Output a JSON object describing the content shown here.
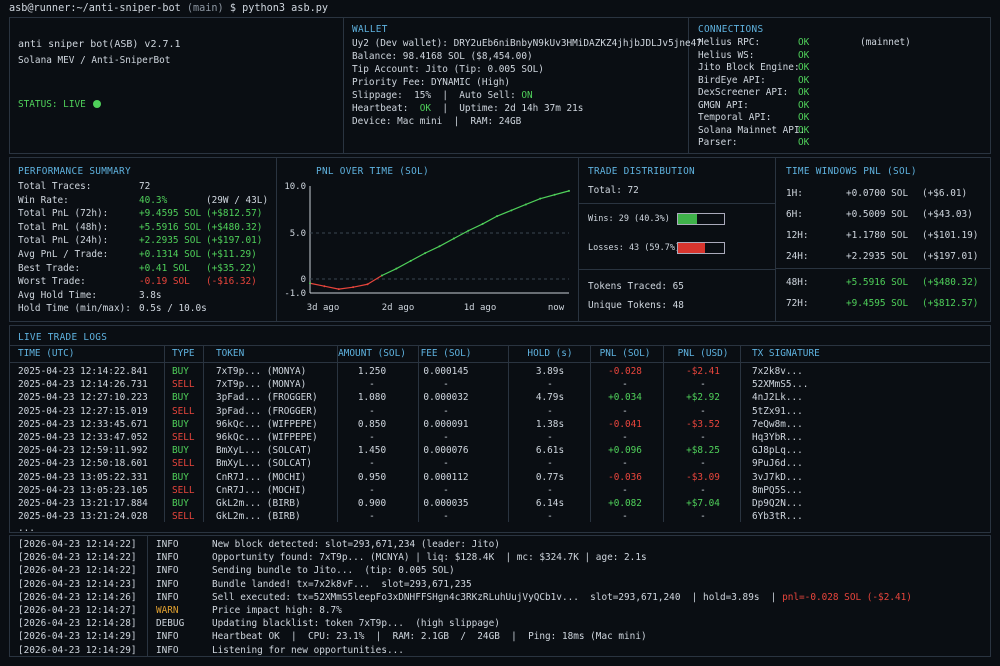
{
  "terminal": {
    "prompt_user": "asb@runner",
    "prompt_path": ":~/anti-sniper-bot",
    "prompt_branch": "(main)",
    "prompt_cmd": "$ python3 asb.py"
  },
  "app": {
    "name": "anti sniper bot(ASB) v2.7.1",
    "subtitle": "Solana MEV / Anti-SniperBot",
    "status_label": "STATUS:",
    "status_value": "LIVE"
  },
  "wallet": {
    "title": "WALLET",
    "lines": [
      "Uy2 (Dev wallet): DRY2uEb6niBnbyN9kUv3HMiDAZKZ4jhjbJDLJv5jne47",
      "Balance: 98.4168 SOL ($8,454.00)",
      "Tip Account: Jito (Tip: 0.005 SOL)",
      "Priority Fee: DYNAMIC (High)"
    ],
    "slippage_label": "Slippage:",
    "slippage_value": "15%",
    "autosell_label": "|  Auto Sell:",
    "autosell_value": "ON",
    "heartbeat_label": "Heartbeat:",
    "heartbeat_value": "OK",
    "uptime": "|  Uptime: 2d 14h 37m 21s",
    "device": "Device: Mac mini  |  RAM: 24GB"
  },
  "connections": {
    "title": "CONNECTIONS",
    "items": [
      {
        "name": "Helius RPC:",
        "status": "OK",
        "note": "(mainnet)"
      },
      {
        "name": "Helius WS:",
        "status": "OK",
        "note": ""
      },
      {
        "name": "Jito Block Engine:",
        "status": "OK",
        "note": ""
      },
      {
        "name": "BirdEye API:",
        "status": "OK",
        "note": ""
      },
      {
        "name": "DexScreener API:",
        "status": "OK",
        "note": ""
      },
      {
        "name": "GMGN API:",
        "status": "OK",
        "note": ""
      },
      {
        "name": "Temporal API:",
        "status": "OK",
        "note": ""
      },
      {
        "name": "Solana Mainnet API:",
        "status": "OK",
        "note": ""
      },
      {
        "name": "Parser:",
        "status": "OK",
        "note": ""
      }
    ]
  },
  "performance": {
    "title": "PERFORMANCE SUMMARY",
    "rows": [
      {
        "label": "Total Traces:",
        "value": "72",
        "extra": "",
        "color": "plain"
      },
      {
        "label": "Win Rate:",
        "value": "40.3%",
        "extra": "(29W / 43L)",
        "color": "green_extra_plain"
      },
      {
        "label": "Total PnL (72h):",
        "value": "+9.4595 SOL",
        "extra": "(+$812.57)",
        "color": "green"
      },
      {
        "label": "Total PnL (48h):",
        "value": "+5.5916 SOL",
        "extra": "(+$480.32)",
        "color": "green"
      },
      {
        "label": "Total PnL (24h):",
        "value": "+2.2935 SOL",
        "extra": "(+$197.01)",
        "color": "green"
      },
      {
        "label": "Avg PnL / Trade:",
        "value": "+0.1314 SOL",
        "extra": "(+$11.29)",
        "color": "green"
      },
      {
        "label": "Best Trade:",
        "value": "+0.41 SOL",
        "extra": "(+$35.22)",
        "color": "green"
      },
      {
        "label": "Worst Trade:",
        "value": "-0.19 SOL",
        "extra": "(-$16.32)",
        "color": "red"
      },
      {
        "label": "Avg Hold Time:",
        "value": "3.8s",
        "extra": "",
        "color": "plain"
      },
      {
        "label": "Hold Time (min/max):",
        "value": "0.5s / 10.0s",
        "extra": "",
        "color": "plain"
      }
    ]
  },
  "pnl_chart": {
    "title": "PNL OVER TIME (SOL)",
    "y_ticks": [
      "10.0",
      "5.0",
      "0",
      "-1.0"
    ],
    "x_ticks": [
      "3d ago",
      "2d ago",
      "1d ago",
      "now"
    ]
  },
  "chart_data": {
    "type": "line",
    "title": "PNL OVER TIME (SOL)",
    "xlabel": "",
    "ylabel": "",
    "ylim": [
      -1.0,
      10.0
    ],
    "x_tick_labels": [
      "3d ago",
      "2d ago",
      "1d ago",
      "now"
    ],
    "x_range": [
      0,
      72
    ],
    "x": [
      0,
      4,
      8,
      12,
      16,
      20,
      24,
      28,
      32,
      36,
      40,
      44,
      48,
      52,
      56,
      60,
      64,
      68,
      72
    ],
    "series": [
      {
        "values": [
          0.0,
          -0.3,
          -0.6,
          -0.4,
          -0.1,
          0.8,
          1.5,
          2.3,
          3.1,
          3.8,
          4.6,
          5.4,
          6.1,
          6.9,
          7.5,
          8.1,
          8.7,
          9.1,
          9.5
        ]
      }
    ],
    "grid": false
  },
  "trade_distribution": {
    "title": "TRADE DISTRIBUTION",
    "total": "Total: 72",
    "wins_label": "Wins: 29 (40.3%)",
    "wins_fraction": 0.403,
    "losses_label": "Losses: 43 (59.7%)",
    "losses_fraction": 0.597,
    "tokens_traced": "Tokens Traced: 65",
    "unique_tokens": "Unique Tokens: 48",
    "colors": {
      "win": "#3fb24a",
      "loss": "#d8352e"
    }
  },
  "time_windows": {
    "title": "TIME WINDOWS PNL (SOL)",
    "rows": [
      {
        "window": "1H:",
        "sol": "+0.0700 SOL",
        "usd": "(+$6.01)",
        "green": false
      },
      {
        "window": "6H:",
        "sol": "+0.5009 SOL",
        "usd": "(+$43.03)",
        "green": false
      },
      {
        "window": "12H:",
        "sol": "+1.1780 SOL",
        "usd": "(+$101.19)",
        "green": false
      },
      {
        "window": "24H:",
        "sol": "+2.2935 SOL",
        "usd": "(+$197.01)",
        "green": false
      },
      {
        "window": "48H:",
        "sol": "+5.5916 SOL",
        "usd": "(+$480.32)",
        "green": true
      },
      {
        "window": "72H:",
        "sol": "+9.4595 SOL",
        "usd": "(+$812.57)",
        "green": true
      }
    ]
  },
  "trade_logs": {
    "title": "LIVE TRADE LOGS",
    "headers": [
      "TIME (UTC)",
      "TYPE",
      "TOKEN",
      "AMOUNT (SOL)",
      "FEE (SOL)",
      "HOLD (s)",
      "PNL (SOL)",
      "PNL (USD)",
      "TX SIGNATURE"
    ],
    "rows": [
      [
        "2025-04-23 12:14:22.841",
        "BUY",
        "7xT9p... (MONYA)",
        "1.250",
        "0.000145",
        "3.89s",
        "-0.028",
        "-$2.41",
        "7x2k8v..."
      ],
      [
        "2025-04-23 12:14:26.731",
        "SELL",
        "7xT9p... (MONYA)",
        "-",
        "-",
        "-",
        "-",
        "-",
        "52XMmS5..."
      ],
      [
        "2025-04-23 12:27:10.223",
        "BUY",
        "3pFad... (FROGGER)",
        "1.080",
        "0.000032",
        "4.79s",
        "+0.034",
        "+$2.92",
        "4nJ2Lk..."
      ],
      [
        "2025-04-23 12:27:15.019",
        "SELL",
        "3pFad... (FROGGER)",
        "-",
        "-",
        "-",
        "-",
        "-",
        "5tZx91..."
      ],
      [
        "2025-04-23 12:33:45.671",
        "BUY",
        "96kQc... (WIFPEPE)",
        "0.850",
        "0.000091",
        "1.38s",
        "-0.041",
        "-$3.52",
        "7eQw8m..."
      ],
      [
        "2025-04-23 12:33:47.052",
        "SELL",
        "96kQc... (WIFPEPE)",
        "-",
        "-",
        "-",
        "-",
        "-",
        "Hq3YbR..."
      ],
      [
        "2025-04-23 12:59:11.992",
        "BUY",
        "BmXyL... (SOLCAT)",
        "1.450",
        "0.000076",
        "6.61s",
        "+0.096",
        "+$8.25",
        "GJ8pLq..."
      ],
      [
        "2025-04-23 12:50:18.601",
        "SELL",
        "BmXyL... (SOLCAT)",
        "-",
        "-",
        "-",
        "-",
        "-",
        "9PuJ6d..."
      ],
      [
        "2025-04-23 13:05:22.331",
        "BUY",
        "CnR7J... (MOCHI)",
        "0.950",
        "0.000112",
        "0.77s",
        "-0.036",
        "-$3.09",
        "3vJ7kD..."
      ],
      [
        "2025-04-23 13:05:23.105",
        "SELL",
        "CnR7J... (MOCHI)",
        "-",
        "-",
        "-",
        "-",
        "-",
        "8mPQ5S..."
      ],
      [
        "2025-04-23 13:21:17.884",
        "BUY",
        "GkL2m... (BIRB)",
        "0.900",
        "0.000035",
        "6.14s",
        "+0.082",
        "+$7.04",
        "Dp9Q2N..."
      ],
      [
        "2025-04-23 13:21:24.028",
        "SELL",
        "GkL2m... (BIRB)",
        "-",
        "-",
        "-",
        "-",
        "-",
        "6Yb3tR..."
      ]
    ],
    "ellipsis": "..."
  },
  "console": {
    "lines": [
      {
        "ts": "[2026-04-23 12:14:22]",
        "level": "INFO",
        "msg": "New block detected: slot=293,671,234 (leader: Jito)",
        "tail": ""
      },
      {
        "ts": "[2026-04-23 12:14:22]",
        "level": "INFO",
        "msg": "Opportunity found: 7xT9p... (MCNYA) | liq: $128.4K  | mc: $324.7K | age: 2.1s",
        "tail": ""
      },
      {
        "ts": "[2026-04-23 12:14:22]",
        "level": "INFO",
        "msg": "Sending bundle to Jito...  (tip: 0.005 SOL)",
        "tail": ""
      },
      {
        "ts": "[2026-04-23 12:14:23]",
        "level": "INFO",
        "msg": "Bundle landed! tx=7x2k8vF...  slot=293,671,235",
        "tail": ""
      },
      {
        "ts": "[2026-04-23 12:14:26]",
        "level": "INFO",
        "msg": "Sell executed: tx=52XMmS5leepFo3xDNHFFSHgn4c3RKzRLuhUujVyQCb1v...  slot=293,671,240  | hold=3.89s  |",
        "tail": "pnl=-0.028 SOL (-$2.41)"
      },
      {
        "ts": "[2026-04-23 12:14:27]",
        "level": "WARN",
        "msg": "Price impact high: 8.7%",
        "tail": ""
      },
      {
        "ts": "[2026-04-23 12:14:28]",
        "level": "DEBUG",
        "msg": "Updating blacklist: token 7xT9p...  (high slippage)",
        "tail": ""
      },
      {
        "ts": "[2026-04-23 12:14:29]",
        "level": "INFO",
        "msg": "Heartbeat OK  |  CPU: 23.1%  |  RAM: 2.1GB  /  24GB  |  Ping: 18ms (Mac mini)",
        "tail": ""
      },
      {
        "ts": "[2026-04-23 12:14:29]",
        "level": "INFO",
        "msg": "Listening for new opportunities...",
        "tail": ""
      }
    ]
  }
}
